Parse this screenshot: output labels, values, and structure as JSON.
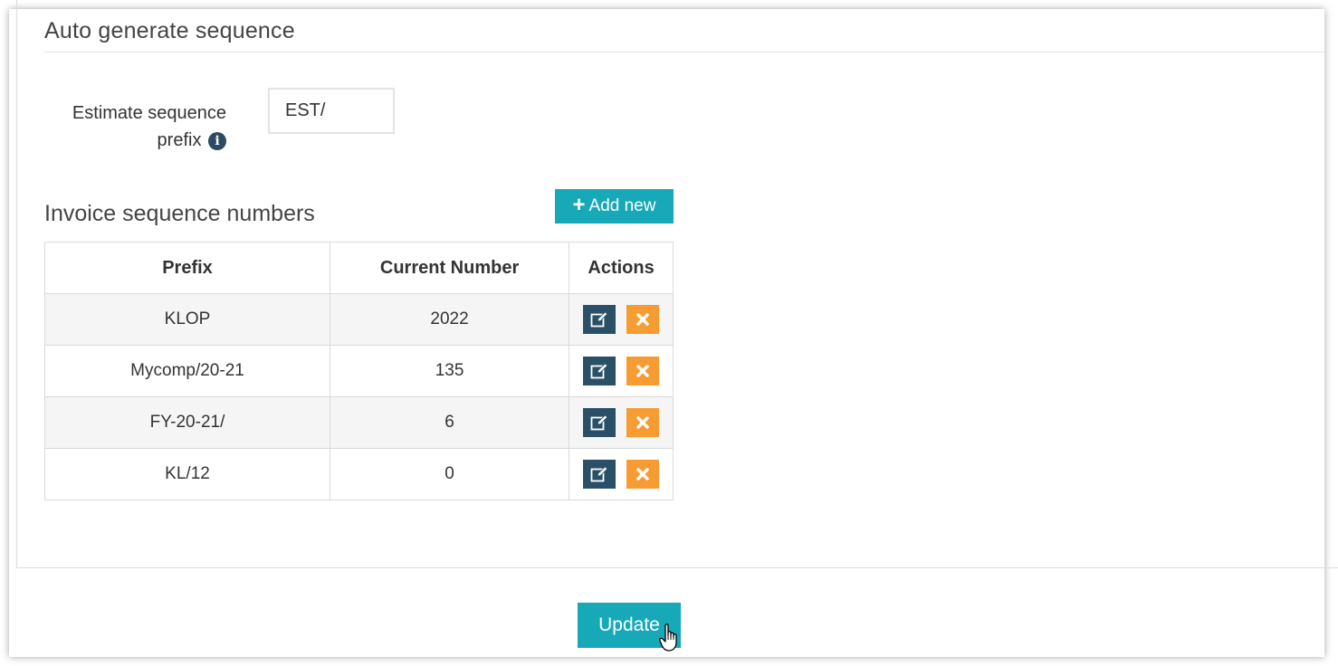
{
  "section": {
    "title": "Auto generate sequence"
  },
  "estimate": {
    "label": "Estimate sequence prefix",
    "info_icon": "info-circle-icon",
    "value": "EST/"
  },
  "invoice": {
    "title": "Invoice sequence numbers",
    "add_label": "Add new",
    "add_icon": "plus-icon",
    "columns": [
      "Prefix",
      "Current Number",
      "Actions"
    ],
    "rows": [
      {
        "prefix": "KLOP",
        "number": "2022"
      },
      {
        "prefix": "Mycomp/20-21",
        "number": "135"
      },
      {
        "prefix": "FY-20-21/",
        "number": "6"
      },
      {
        "prefix": "KL/12",
        "number": "0"
      }
    ],
    "edit_icon": "edit-icon",
    "delete_icon": "close-icon"
  },
  "footer": {
    "update_label": "Update"
  },
  "colors": {
    "accent": "#17a9b8",
    "edit": "#2a5068",
    "delete": "#f79b33"
  }
}
